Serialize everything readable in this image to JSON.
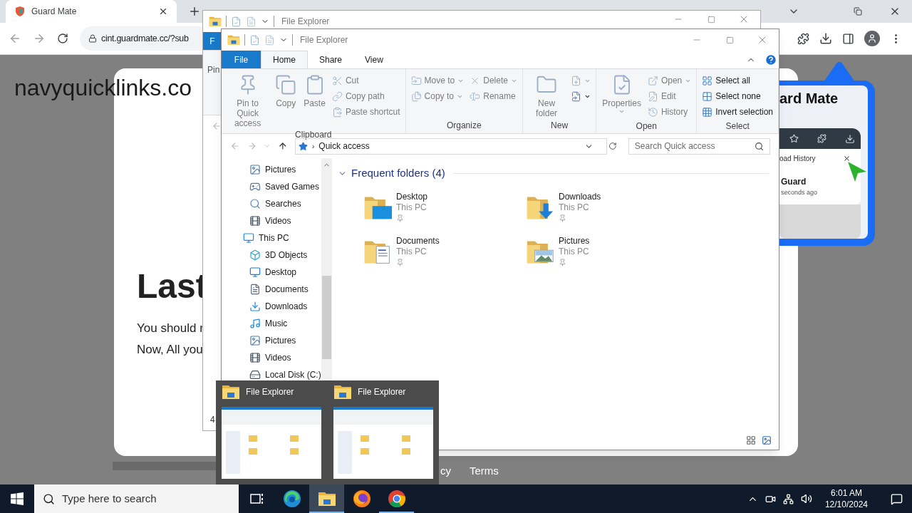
{
  "browser": {
    "tab_title": "Guard Mate",
    "address": "cint.guardmate.cc/?sub",
    "page": {
      "site_name": "navyquicklinks.co",
      "heading": "Last",
      "lines": [
        "You should r",
        "Now, All you"
      ],
      "footer_links": [
        "cy",
        "Terms"
      ]
    },
    "promo": {
      "title": "ard Mate",
      "history_title": "oad History",
      "item_name": "Guard",
      "item_time": "seconds ago"
    }
  },
  "back_window": {
    "title": "File Explorer",
    "file_tab": "F",
    "ribbon_text": "Pin",
    "status": "4"
  },
  "explorer": {
    "title": "File Explorer",
    "tabs": [
      {
        "label": "File",
        "kind": "file",
        "selected": false
      },
      {
        "label": "Home",
        "kind": "tab",
        "selected": true
      },
      {
        "label": "Share",
        "kind": "tab",
        "selected": false
      },
      {
        "label": "View",
        "kind": "tab",
        "selected": false
      }
    ],
    "ribbon": [
      {
        "label": "Clipboard",
        "columns": [
          {
            "kind": "large",
            "items": [
              {
                "label": "Pin to Quick access",
                "kind": "pin",
                "disabled": true,
                "dropdown": false
              }
            ]
          },
          {
            "kind": "large",
            "items": [
              {
                "label": "Copy",
                "kind": "copy",
                "disabled": true,
                "dropdown": false
              }
            ]
          },
          {
            "kind": "large",
            "items": [
              {
                "label": "Paste",
                "kind": "paste",
                "disabled": true,
                "dropdown": false
              }
            ]
          },
          {
            "kind": "stack",
            "items": [
              {
                "label": "Cut",
                "kind": "cut",
                "disabled": true,
                "dropdown": false
              },
              {
                "label": "Copy path",
                "kind": "copy-path",
                "disabled": true,
                "dropdown": false
              },
              {
                "label": "Paste shortcut",
                "kind": "paste-shortcut",
                "disabled": true,
                "dropdown": false
              }
            ]
          }
        ]
      },
      {
        "label": "Organize",
        "columns": [
          {
            "kind": "stack",
            "items": [
              {
                "label": "Move to",
                "kind": "move",
                "disabled": true,
                "dropdown": true
              },
              {
                "label": "Copy to",
                "kind": "copy-to",
                "disabled": true,
                "dropdown": true
              }
            ]
          },
          {
            "kind": "stack",
            "items": [
              {
                "label": "Delete",
                "kind": "delete",
                "disabled": true,
                "dropdown": true
              },
              {
                "label": "Rename",
                "kind": "rename",
                "disabled": true,
                "dropdown": false
              }
            ]
          }
        ]
      },
      {
        "label": "New",
        "columns": [
          {
            "kind": "large",
            "items": [
              {
                "label": "New folder",
                "kind": "new-folder",
                "disabled": true,
                "dropdown": false
              }
            ]
          },
          {
            "kind": "stack",
            "items": [
              {
                "kind": "new-item",
                "disabled": true,
                "dropdown": true
              },
              {
                "kind": "easy-access",
                "disabled": false,
                "dropdown": true
              }
            ]
          }
        ]
      },
      {
        "label": "Open",
        "columns": [
          {
            "kind": "large",
            "items": [
              {
                "label": "Properties",
                "kind": "properties",
                "disabled": true,
                "dropdown": true
              }
            ]
          },
          {
            "kind": "stack",
            "items": [
              {
                "label": "Open",
                "kind": "open",
                "disabled": true,
                "dropdown": true
              },
              {
                "label": "Edit",
                "kind": "edit",
                "disabled": true,
                "dropdown": false
              },
              {
                "label": "History",
                "kind": "history",
                "disabled": true,
                "dropdown": false
              }
            ]
          }
        ]
      },
      {
        "label": "Select",
        "columns": [
          {
            "kind": "stack",
            "items": [
              {
                "label": "Select all",
                "kind": "select-all",
                "disabled": false,
                "dropdown": false
              },
              {
                "label": "Select none",
                "kind": "select-none",
                "disabled": false,
                "dropdown": false
              },
              {
                "label": "Invert selection",
                "kind": "invert",
                "disabled": false,
                "dropdown": false
              }
            ]
          }
        ]
      }
    ],
    "address_separator": "›",
    "address": "Quick access",
    "search_placeholder": "Search Quick access",
    "nav_items": [
      {
        "label": "Pictures",
        "kind": "pictures"
      },
      {
        "label": "Saved Games",
        "kind": "games"
      },
      {
        "label": "Searches",
        "kind": "search"
      },
      {
        "label": "Videos",
        "kind": "videos"
      },
      {
        "label": "This PC",
        "kind": "pc",
        "children": [
          {
            "label": "3D Objects",
            "kind": "objects"
          },
          {
            "label": "Desktop",
            "kind": "desktop"
          },
          {
            "label": "Documents",
            "kind": "documents"
          },
          {
            "label": "Downloads",
            "kind": "downloads"
          },
          {
            "label": "Music",
            "kind": "music"
          },
          {
            "label": "Pictures",
            "kind": "pictures"
          },
          {
            "label": "Videos",
            "kind": "videos"
          },
          {
            "label": "Local Disk (C:)",
            "kind": "disk"
          }
        ]
      }
    ],
    "section": "Frequent folders (4)",
    "folders": [
      {
        "name": "Desktop",
        "location": "This PC",
        "kind": "desktop",
        "pinned": true
      },
      {
        "name": "Downloads",
        "location": "This PC",
        "kind": "downloads",
        "pinned": true
      },
      {
        "name": "Documents",
        "location": "This PC",
        "kind": "documents",
        "pinned": true
      },
      {
        "name": "Pictures",
        "location": "This PC",
        "kind": "pictures",
        "pinned": true
      }
    ]
  },
  "thumbnails": [
    {
      "title": "File Explorer"
    },
    {
      "title": "File Explorer"
    }
  ],
  "taskbar": {
    "search_placeholder": "Type here to search",
    "apps": [
      {
        "kind": "task-view",
        "selected": false,
        "running": false
      },
      {
        "kind": "edge",
        "selected": false,
        "running": false
      },
      {
        "kind": "explorer",
        "selected": true,
        "running": true
      },
      {
        "kind": "firefox",
        "selected": false,
        "running": false
      },
      {
        "kind": "chrome",
        "selected": false,
        "running": true
      }
    ],
    "time": "6:01 AM",
    "date": "12/10/2024"
  }
}
